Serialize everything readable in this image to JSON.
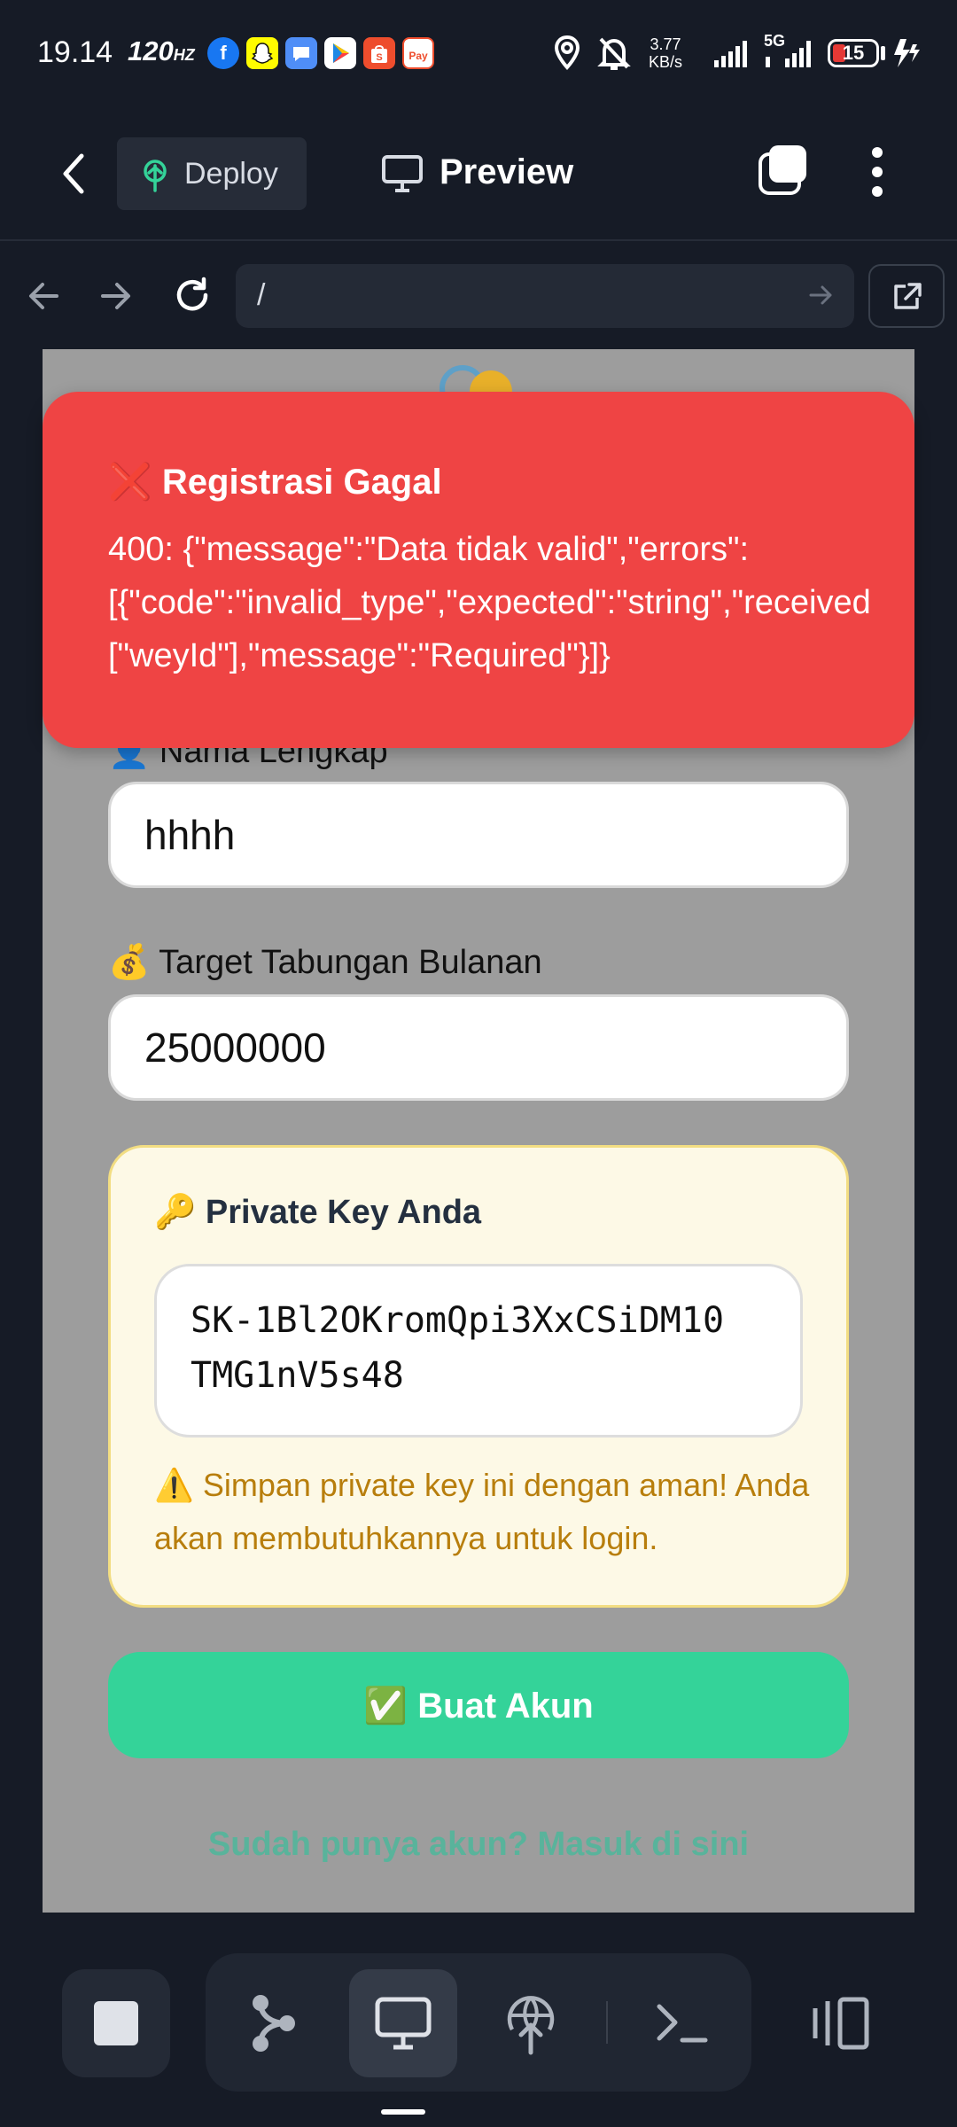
{
  "status_bar": {
    "time": "19.14",
    "refresh_rate": "120",
    "refresh_unit": "HZ",
    "net_speed_value": "3.77",
    "net_speed_unit": "KB/s",
    "network": "5G",
    "battery": "15",
    "notification_icons": [
      "facebook-icon",
      "snapchat-icon",
      "messages-icon",
      "play-store-icon",
      "shopee-icon",
      "shopeepay-icon"
    ],
    "shopeepay_label": "Pay"
  },
  "toolbar": {
    "deploy_label": "Deploy",
    "preview_label": "Preview"
  },
  "url_bar": {
    "url": "/"
  },
  "form": {
    "name_label": "👤 Nama Lengkap",
    "name_value": "hhhh",
    "target_label": "💰 Target Tabungan Bulanan",
    "target_value": "25000000",
    "key_title": "🔑 Private Key Anda",
    "private_key": "SK-1Bl2OKromQpi3XxCSiDM10\nTMG1nV5s48",
    "warning": "⚠️ Simpan private key ini dengan aman! Anda akan membutuhkannya untuk login.",
    "create_button": "✅ Buat Akun",
    "login_link": "Sudah punya akun? Masuk di sini"
  },
  "toast": {
    "title": "❌ Registrasi Gagal",
    "message": "400: {\"message\":\"Data tidak valid\",\"errors\":\n[{\"code\":\"invalid_type\",\"expected\":\"string\",\"received\n[\"weyId\"],\"message\":\"Required\"}]}"
  },
  "colors": {
    "toast_bg": "#ef4444",
    "button_green": "#34d399",
    "app_bg": "#161b26"
  }
}
